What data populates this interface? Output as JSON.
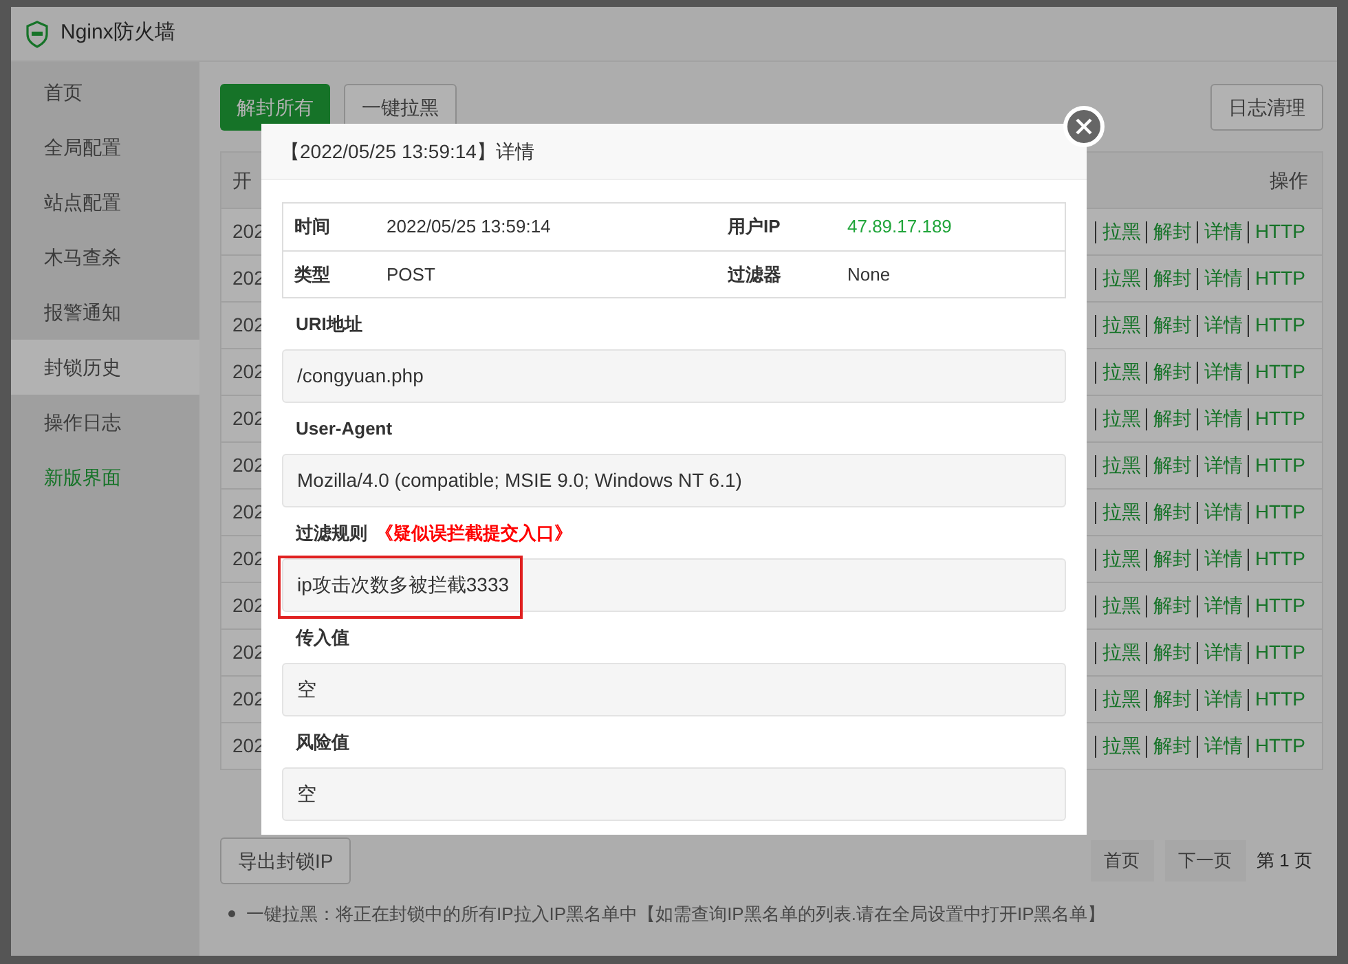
{
  "window": {
    "title": "Nginx防火墙"
  },
  "sidebar": {
    "items": [
      {
        "label": "首页",
        "selected": false,
        "kind": "page"
      },
      {
        "label": "全局配置",
        "selected": false,
        "kind": "page"
      },
      {
        "label": "站点配置",
        "selected": false,
        "kind": "page"
      },
      {
        "label": "木马查杀",
        "selected": false,
        "kind": "page"
      },
      {
        "label": "报警通知",
        "selected": false,
        "kind": "page"
      },
      {
        "label": "封锁历史",
        "selected": true,
        "kind": "page"
      },
      {
        "label": "操作日志",
        "selected": false,
        "kind": "page"
      },
      {
        "label": "新版界面",
        "selected": false,
        "kind": "link"
      }
    ]
  },
  "toolbar": {
    "buttons": [
      {
        "label": "解封所有",
        "kind": "primary"
      },
      {
        "label": "一键拉黑",
        "kind": "default"
      }
    ],
    "clear_button": "日志清理"
  },
  "table": {
    "columns": [
      "开",
      "操作"
    ],
    "rows": [
      {
        "cell": "202",
        "actions": [
          "拉黑",
          "解封",
          "详情",
          "HTTP"
        ]
      },
      {
        "cell": "202",
        "actions": [
          "拉黑",
          "解封",
          "详情",
          "HTTP"
        ]
      },
      {
        "cell": "202",
        "actions": [
          "拉黑",
          "解封",
          "详情",
          "HTTP"
        ]
      },
      {
        "cell": "202",
        "actions": [
          "拉黑",
          "解封",
          "详情",
          "HTTP"
        ]
      },
      {
        "cell": "202",
        "actions": [
          "拉黑",
          "解封",
          "详情",
          "HTTP"
        ]
      },
      {
        "cell": "202",
        "actions": [
          "拉黑",
          "解封",
          "详情",
          "HTTP"
        ]
      },
      {
        "cell": "202",
        "actions": [
          "拉黑",
          "解封",
          "详情",
          "HTTP"
        ]
      },
      {
        "cell": "202",
        "actions": [
          "拉黑",
          "解封",
          "详情",
          "HTTP"
        ]
      },
      {
        "cell": "202",
        "actions": [
          "拉黑",
          "解封",
          "详情",
          "HTTP"
        ]
      },
      {
        "cell": "202",
        "actions": [
          "拉黑",
          "解封",
          "详情",
          "HTTP"
        ]
      },
      {
        "cell": "202",
        "actions": [
          "拉黑",
          "解封",
          "详情",
          "HTTP"
        ]
      },
      {
        "cell": "202",
        "actions": [
          "拉黑",
          "解封",
          "详情",
          "HTTP"
        ]
      }
    ]
  },
  "footer": {
    "export_button": "导出封锁IP",
    "pagination": {
      "first": "首页",
      "next": "下一页",
      "current": "第 1 页"
    },
    "note": "一键拉黑：将正在封锁中的所有IP拉入IP黑名单中【如需查询IP黑名单的列表.请在全局设置中打开IP黑名单】"
  },
  "dialog": {
    "title": "【2022/05/25 13:59:14】详情",
    "info": [
      [
        {
          "label": "时间",
          "value": "2022/05/25 13:59:14",
          "kind": "text"
        },
        {
          "label": "用户IP",
          "value": "47.89.17.189",
          "kind": "ip"
        }
      ],
      [
        {
          "label": "类型",
          "value": "POST",
          "kind": "text"
        },
        {
          "label": "过滤器",
          "value": "None",
          "kind": "text"
        }
      ]
    ],
    "sections": [
      {
        "label": "URI地址",
        "value": "/congyuan.php",
        "highlighted": false
      },
      {
        "label": "User-Agent",
        "value": "Mozilla/4.0 (compatible; MSIE 9.0; Windows NT 6.1)",
        "highlighted": false
      },
      {
        "label": "过滤规则",
        "link": "《疑似误拦截提交入口》",
        "value": "ip攻击次数多被拦截3333",
        "highlighted": true
      },
      {
        "label": "传入值",
        "value": "空",
        "highlighted": false
      },
      {
        "label": "风险值",
        "value": "空",
        "highlighted": false
      }
    ]
  }
}
